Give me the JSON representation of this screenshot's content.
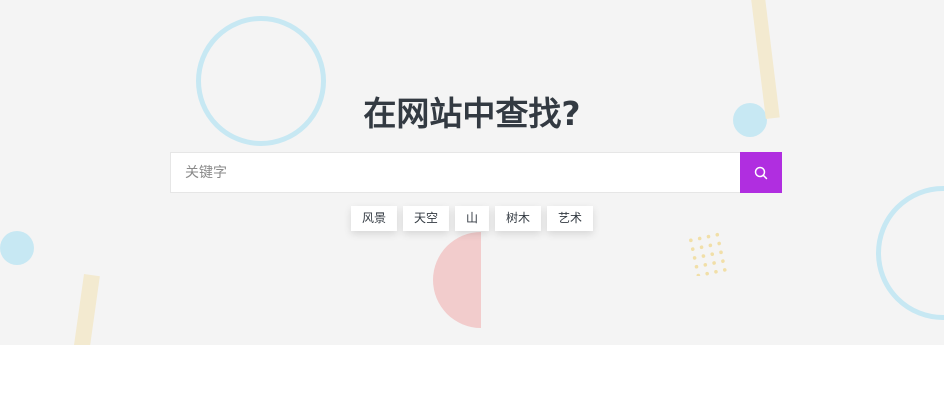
{
  "hero": {
    "title": "在网站中查找?",
    "search": {
      "placeholder": "关键字",
      "value": "",
      "button_icon": "search-icon",
      "button_color": "#b02ee0"
    },
    "tags": [
      {
        "label": "风景"
      },
      {
        "label": "天空"
      },
      {
        "label": "山"
      },
      {
        "label": "树木"
      },
      {
        "label": "艺术"
      }
    ]
  },
  "colors": {
    "hero_background": "#f4f4f4",
    "title": "#333a42",
    "accent": "#b02ee0",
    "deco_blue": "#c7e8f3",
    "deco_yellow": "#f3ead0",
    "deco_pink": "#f2cccc"
  }
}
